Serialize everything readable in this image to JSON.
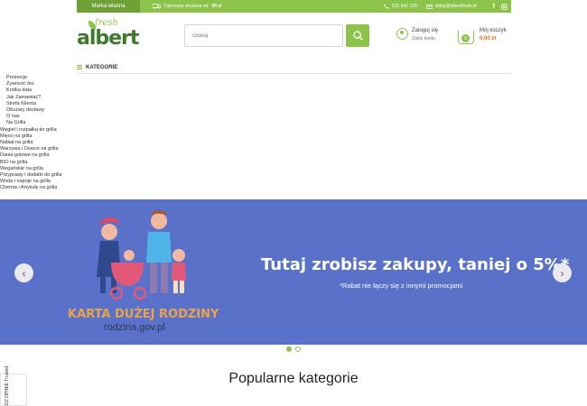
{
  "topbar": {
    "brand_tab": "Marka własna",
    "delivery_text": "Darmowa dostawa od",
    "delivery_amount": "99 zł",
    "phone": "531 542 100",
    "email": "sklep@albertfresh.pl",
    "social": [
      "facebook-icon",
      "instagram-icon"
    ]
  },
  "logo": {
    "fresh": "fresh",
    "albert": "albert"
  },
  "search": {
    "placeholder": "szukaj"
  },
  "account": {
    "login": "Zaloguj się",
    "register": "Załóż konto"
  },
  "cart": {
    "label": "Mój koszyk",
    "total": "0,00 zł",
    "count": "0"
  },
  "categories_label": "KATEGORIE",
  "menu": {
    "items": [
      "Promocje",
      "Żywność bio",
      "Krótka data",
      "Jak Zamawiać?",
      "Strefa Klienta",
      "Obszary dostawy",
      "O nas",
      "Na Grilla"
    ],
    "grill": [
      "Węgiel i rozpałka do grilla",
      "Mięso na grilla",
      "Nabiał na grilla",
      "Warzywa i Owoce na grilla",
      "Dania gotowe na grilla",
      "BIO na grilla",
      "Wegańskie na grilla",
      "Przyprawy i dodatki do grilla",
      "Woda i napoje na grilla",
      "Chemia i Artykuły na grilla"
    ]
  },
  "banner": {
    "headline": "Tutaj zrobisz zakupy, taniej o 5%*",
    "note": "*Rabat nie łączy się z innymi promocjami",
    "card_title": "KARTA DUŻEJ RODZINY",
    "card_url": "rodzina.gov.pl",
    "bg": "#5a71c9"
  },
  "popular_title": "Popularne kategorie",
  "trust_label": "DZ OPINIE Trusted",
  "colors": {
    "accent": "#8cc34b",
    "dark_green": "#3d7a2d",
    "price": "#e36f1e"
  }
}
